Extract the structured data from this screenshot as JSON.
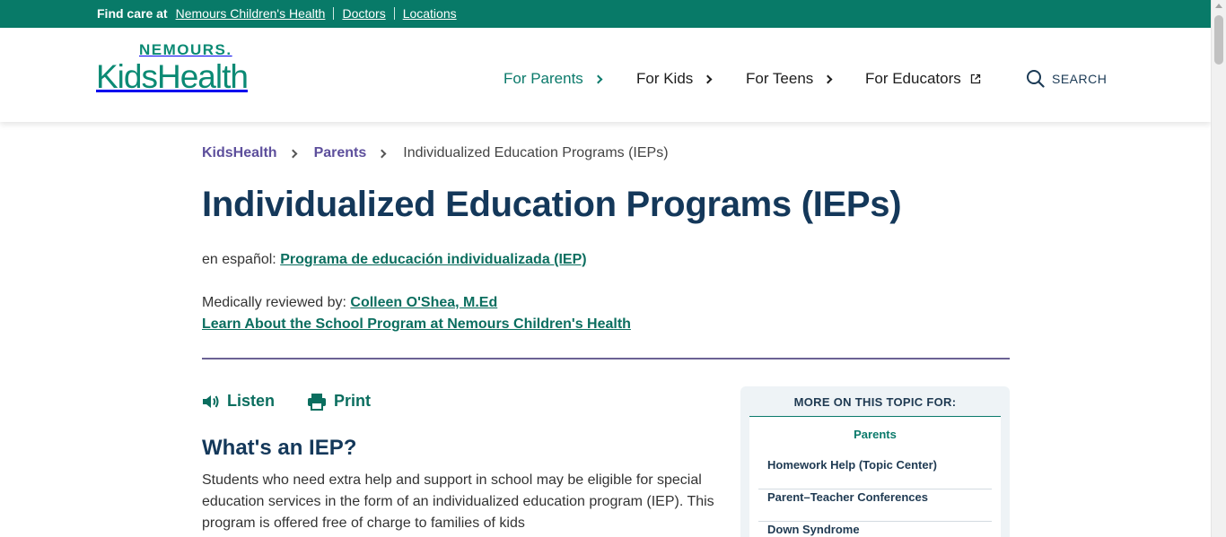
{
  "topbar": {
    "lead": "Find care at",
    "links": [
      "Nemours Children's Health",
      "Doctors",
      "Locations"
    ]
  },
  "header": {
    "logo_top": "NEMOURS.",
    "logo_main": "KidsHealth",
    "nav": [
      {
        "label": "For Parents",
        "icon": "chevron-right-icon"
      },
      {
        "label": "For Kids",
        "icon": "chevron-right-icon"
      },
      {
        "label": "For Teens",
        "icon": "chevron-right-icon"
      },
      {
        "label": "For Educators",
        "icon": "external-link-icon"
      }
    ],
    "search_label": "SEARCH"
  },
  "breadcrumb": {
    "items": [
      "KidsHealth",
      "Parents"
    ],
    "current": "Individualized Education Programs (IEPs)"
  },
  "article": {
    "title": "Individualized Education Programs (IEPs)",
    "espanol_prefix": "en español:",
    "espanol_link": "Programa de educación individualizada (IEP)",
    "reviewed_prefix": "Medically reviewed by:",
    "reviewer": "Colleen O'Shea, M.Ed",
    "learn_link": "Learn About the School Program at Nemours Children's Health",
    "tools": {
      "listen": "Listen",
      "print": "Print"
    },
    "section_heading": "What's an IEP?",
    "paragraph": "Students who need extra help and support in school may be eligible for special education services in the form of an individualized education program (IEP). This program is offered free of charge to families of kids"
  },
  "sidebar": {
    "heading": "MORE ON THIS TOPIC FOR:",
    "audience": "Parents",
    "items": [
      "Homework Help (Topic Center)",
      "Parent–Teacher Conferences",
      "Down Syndrome"
    ]
  },
  "colors": {
    "brand_green": "#087a68",
    "title_navy": "#14385a",
    "breadcrumb_purple": "#5d4f9c"
  }
}
